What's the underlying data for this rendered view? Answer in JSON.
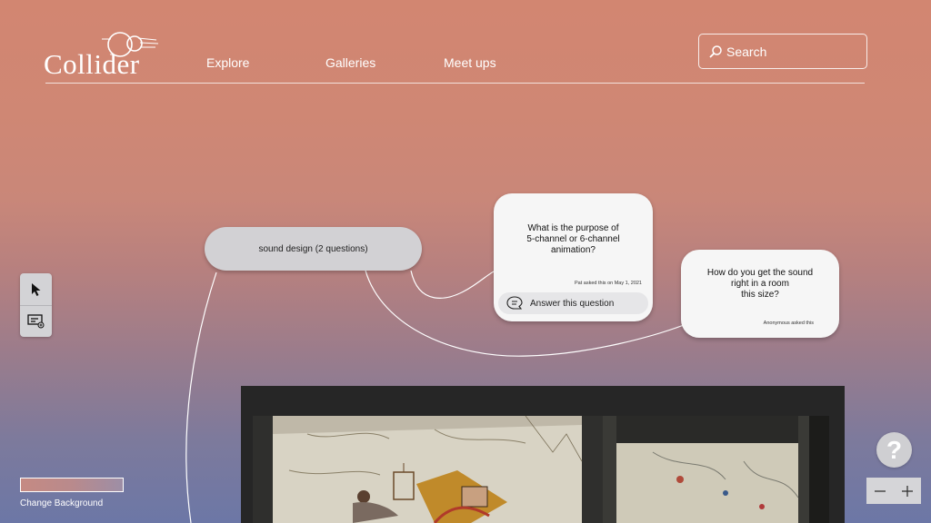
{
  "header": {
    "logo_text": "Collider",
    "nav": [
      {
        "label": "Explore"
      },
      {
        "label": "Galleries"
      },
      {
        "label": "Meet ups"
      }
    ],
    "search": {
      "placeholder": "Search",
      "icon": "search-icon"
    }
  },
  "toolbar": {
    "tools": [
      {
        "icon": "cursor-arrow-icon"
      },
      {
        "icon": "add-card-icon"
      }
    ]
  },
  "topic": {
    "label": "sound design (2 questions)"
  },
  "questions": [
    {
      "text": "What is the purpose of\n5-channel or 6-channel\nanimation?",
      "meta": "Pat asked this on May 1, 2021",
      "answer_label": "Answer this question"
    },
    {
      "text": "How do you get the sound\nright in a room\nthis size?",
      "meta": "Anonymous asked this"
    }
  ],
  "background_control": {
    "label": "Change Background"
  },
  "help": {
    "label": "?"
  },
  "zoom": {
    "minus": "−",
    "plus": "+"
  },
  "colors": {
    "bg_top": "#d28671",
    "bg_bottom": "#6c77a6",
    "card": "#f6f6f6",
    "pill": "#d2d1d4"
  }
}
